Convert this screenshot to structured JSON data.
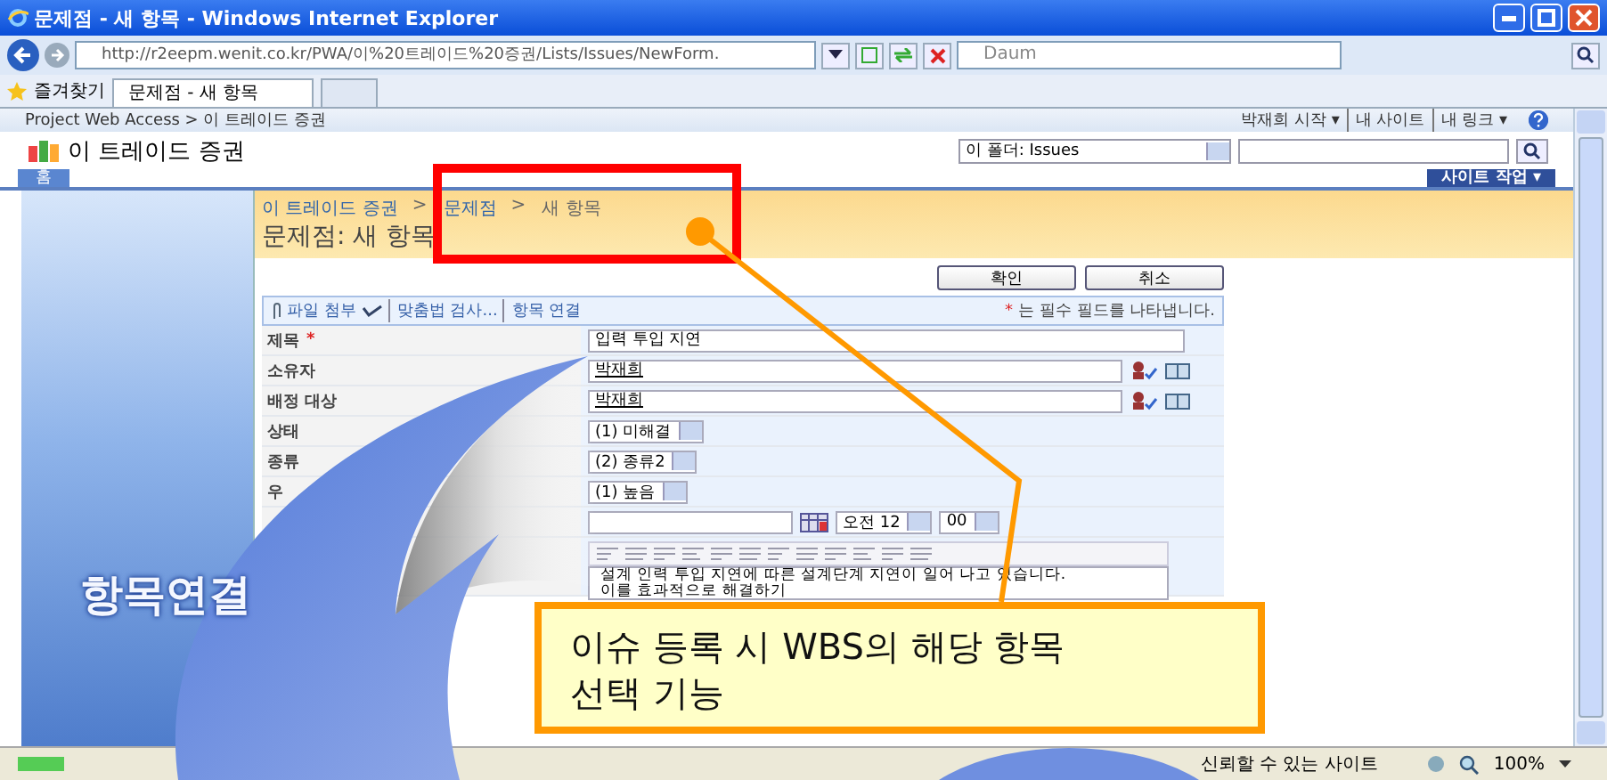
{
  "window": {
    "title": "문제점 - 새 항목 - Windows Internet Explorer"
  },
  "browser": {
    "address": "http://r2eepm.wenit.co.kr/PWA/이%20트레이드%20증권/Lists/Issues/NewForm.",
    "search_placeholder": "Daum",
    "favorites": "즐겨찾기",
    "tab": "문제점 - 새 항목"
  },
  "top_bar": {
    "breadcrumb": "Project Web Access > 이 트레이드 증권",
    "links": [
      "박재희 시작 ▾",
      "내 사이트",
      "내 링크 ▾"
    ]
  },
  "site": {
    "title": "이 트레이드 증권",
    "search_scope": "이 폴더: Issues",
    "nav_tab": "홈",
    "site_actions": "사이트 작업 ▾"
  },
  "breadcrumb": {
    "separator": ">",
    "items": [
      "이 트레이드 증권",
      "문제점",
      "새 항목"
    ]
  },
  "page_title": "문제점: 새 항목",
  "buttons": [
    "확인",
    "취소"
  ],
  "toolbar": {
    "items": [
      "파일 첨부",
      "맞춤법 검사...",
      "항목 연결"
    ],
    "required_mark": "*",
    "required_note": "는 필수 필드를 나타냅니다."
  },
  "fields": [
    {
      "kind": "text",
      "label": "제목",
      "required": true,
      "value": "입력 투입 지연"
    },
    {
      "kind": "person",
      "label": "소유자",
      "required": false,
      "value": "박재희"
    },
    {
      "kind": "person",
      "label": "배정 대상",
      "required": false,
      "value": "박재희"
    },
    {
      "kind": "select",
      "label": "상태",
      "required": false,
      "value": "(1) 미해결"
    },
    {
      "kind": "select",
      "label": "종류",
      "required": false,
      "value": "(2) 종류2"
    },
    {
      "kind": "select",
      "label": "우",
      "required": false,
      "value": "(1) 높음"
    },
    {
      "kind": "datetime",
      "hour": "오전 12",
      "minute": "00"
    },
    {
      "kind": "richtext",
      "value": "설계 인력 투입 지연에 따른 설계단계 지연이 일어 나고 있습니다.\n이를 효과적으로 해결하기"
    }
  ],
  "annotation": {
    "arrow_label": "항목연결",
    "callout": "이슈 등록 시 WBS의 해당 항목\n선택 기능"
  },
  "status_bar": {
    "zone": "신뢰할 수 있는 사이트",
    "zoom": "100%"
  }
}
